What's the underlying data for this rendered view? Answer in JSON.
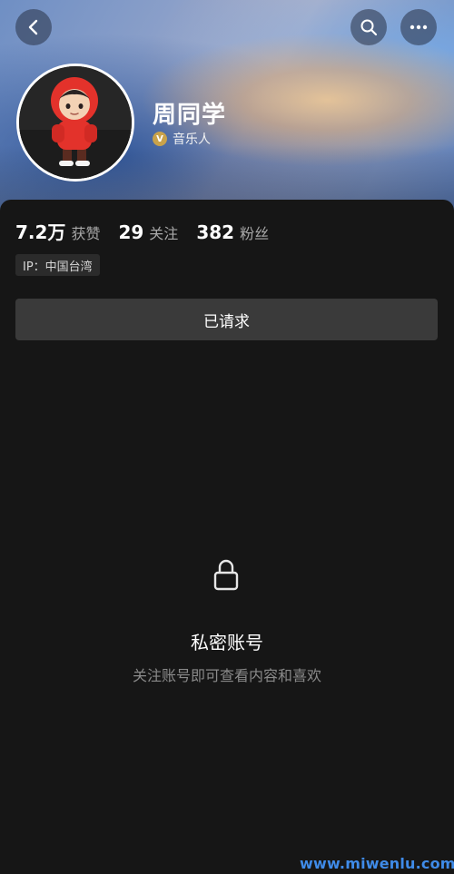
{
  "profile": {
    "name": "周同学",
    "verified_badge": "V",
    "verified_label": "音乐人",
    "avatar_icon": "cartoon-boy-red-hoodie"
  },
  "stats": [
    {
      "value": "7.2万",
      "label": "获赞"
    },
    {
      "value": "29",
      "label": "关注"
    },
    {
      "value": "382",
      "label": "粉丝"
    }
  ],
  "ip": {
    "label": "IP：中国台湾"
  },
  "request_button": {
    "label": "已请求"
  },
  "private": {
    "title": "私密账号",
    "subtitle": "关注账号即可查看内容和喜欢"
  },
  "watermark": "www.miwenlu.com",
  "colors": {
    "background": "#161616",
    "button": "#3a3a3a",
    "muted_text": "#8a8a8a",
    "badge_gold": "#c9a24a",
    "watermark": "#3f8be8"
  },
  "icons": [
    "back-icon",
    "search-icon",
    "more-icon",
    "lock-icon",
    "verified-icon"
  ]
}
